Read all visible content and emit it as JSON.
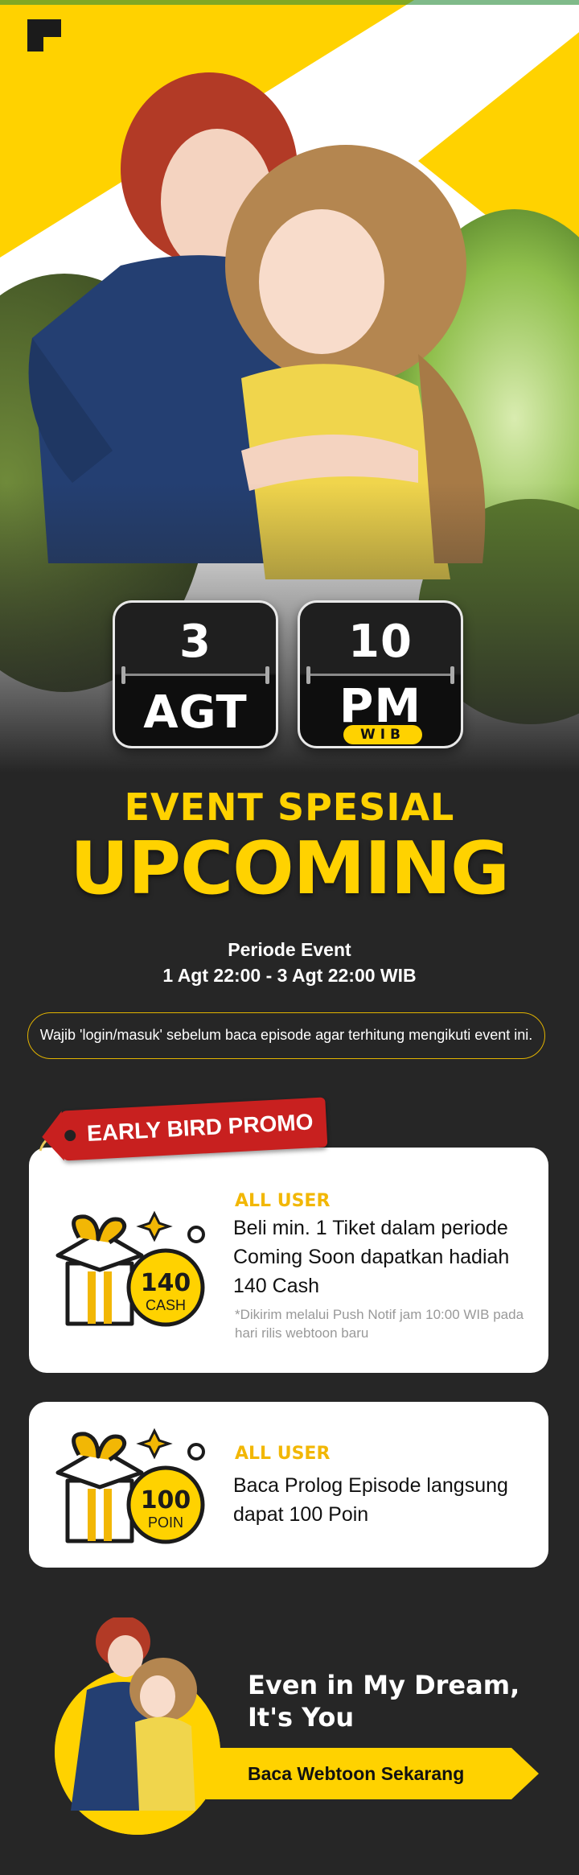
{
  "colors": {
    "accent": "#ffd200",
    "background": "#262626",
    "tag_red": "#c8201f",
    "card_bg": "#ffffff",
    "label_yellow": "#f2b705"
  },
  "hero": {
    "logo": "app-logo-icon",
    "date": {
      "day": "3",
      "month": "AGT"
    },
    "time": {
      "hour": "10",
      "period": "PM",
      "zone": "WIB"
    }
  },
  "event": {
    "title": "EVENT SPESIAL",
    "headline": "UPCOMING",
    "period_label": "Periode Event",
    "period_value": "1 Agt 22:00 - 3 Agt 22:00 WIB",
    "notice": "Wajib 'login/masuk' sebelum baca episode agar terhitung mengikuti event ini."
  },
  "promo": {
    "tag": "EARLY BIRD PROMO",
    "cards": [
      {
        "audience": "ALL USER",
        "description": "Beli min. 1 Tiket dalam periode Coming Soon dapatkan hadiah 140 Cash",
        "note": "*Dikirim melalui Push Notif jam 10:00 WIB pada hari rilis webtoon baru",
        "reward_amount": "140",
        "reward_unit": "CASH",
        "icon": "gift-box-icon"
      },
      {
        "audience": "ALL USER",
        "description": "Baca Prolog Episode langsung dapat 100 Poin",
        "reward_amount": "100",
        "reward_unit": "POIN",
        "icon": "gift-box-icon"
      }
    ]
  },
  "footer": {
    "title_line1": "Even in My Dream,",
    "title_line2": "It's You",
    "cta": "Baca Webtoon Sekarang"
  }
}
